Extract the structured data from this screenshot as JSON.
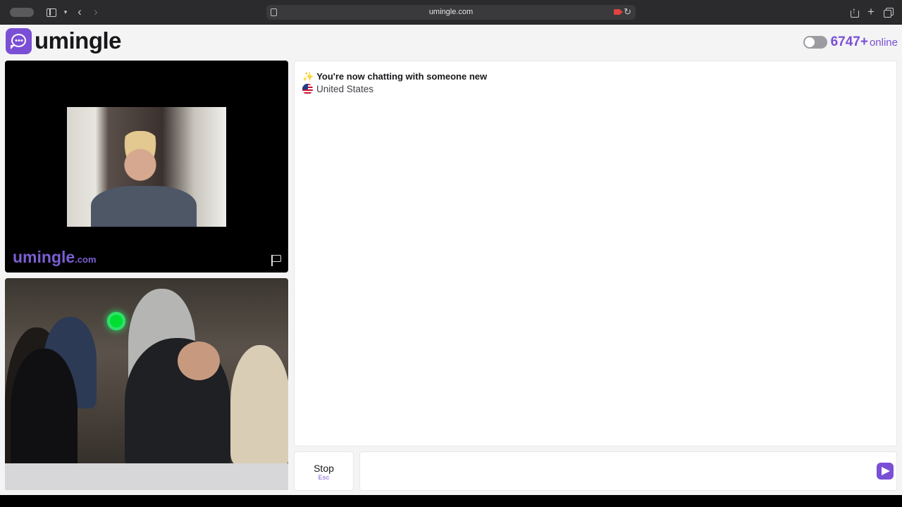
{
  "browser": {
    "url": "umingle.com"
  },
  "header": {
    "logo_text": "umingle",
    "online_count": "6747+",
    "online_label": "online"
  },
  "stranger_video": {
    "watermark_name": "umingle",
    "watermark_domain": ".com"
  },
  "chat": {
    "system_message": "You're now chatting with someone new",
    "sparkle_glyph": "✨",
    "country": "United States"
  },
  "controls": {
    "stop_label": "Stop",
    "stop_shortcut": "Esc",
    "message_value": ""
  },
  "colors": {
    "brand": "#7a4fd6"
  }
}
